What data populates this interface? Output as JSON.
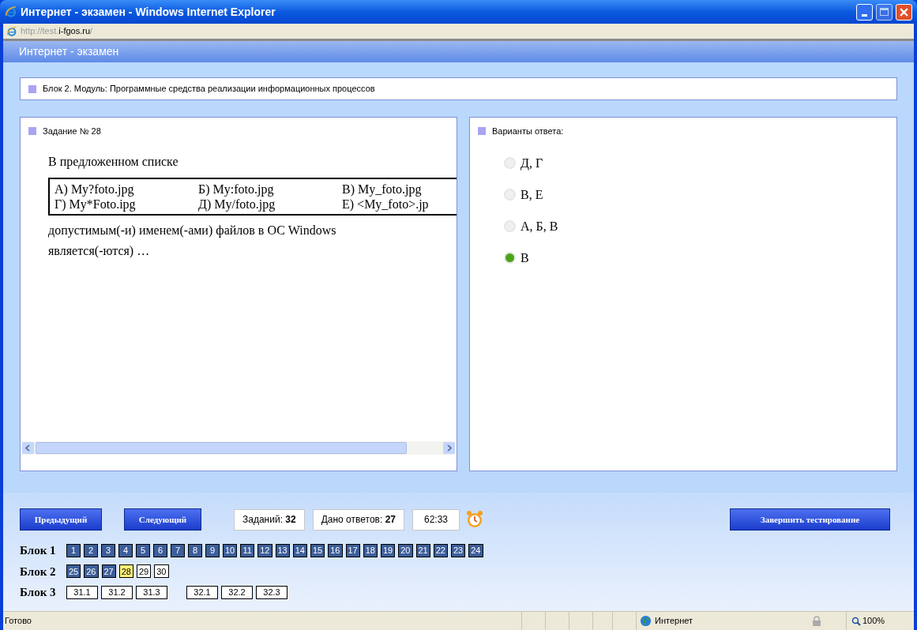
{
  "window": {
    "title": "Интернет - экзамен - Windows Internet Explorer"
  },
  "address": {
    "prefix": "http://test.",
    "domain": "i-fgos.ru",
    "suffix": "/"
  },
  "app_header": {
    "title": "Интернет - экзамен"
  },
  "block_header": {
    "text": "Блок 2. Модуль: Программные средства реализации информационных процессов"
  },
  "question": {
    "title": "Задание № 28",
    "intro": "В предложенном списке",
    "table": [
      [
        "А) My?foto.jpg",
        "Б) My:foto.jpg",
        "В) My_foto.jpg"
      ],
      [
        "Г) My*Foto.ipg",
        "Д) My/foto.jpg",
        "Е) <My_foto>.jp"
      ]
    ],
    "lines": [
      "допустимым(-и) именем(-ами) файлов в ОС Windows",
      "является(-ются) …"
    ]
  },
  "answers": {
    "title": "Варианты ответа:",
    "options": [
      {
        "label": "Д, Г",
        "selected": false
      },
      {
        "label": "В, Е",
        "selected": false
      },
      {
        "label": "А, Б, В",
        "selected": false
      },
      {
        "label": "В",
        "selected": true
      }
    ]
  },
  "toolbar": {
    "prev": "Предыдущий",
    "next": "Следующий",
    "tasks_label": "Заданий:",
    "tasks_value": "32",
    "answered_label": "Дано ответов:",
    "answered_value": "27",
    "timer": "62:33",
    "finish": "Завершить тестирование"
  },
  "blocks": [
    {
      "label": "Блок 1",
      "groups": [
        [
          {
            "n": "1",
            "answered": true,
            "selected": false
          },
          {
            "n": "2",
            "answered": true,
            "selected": false
          },
          {
            "n": "3",
            "answered": true,
            "selected": false
          },
          {
            "n": "4",
            "answered": true,
            "selected": false
          },
          {
            "n": "5",
            "answered": true,
            "selected": false
          },
          {
            "n": "6",
            "answered": true,
            "selected": false
          },
          {
            "n": "7",
            "answered": true,
            "selected": false
          },
          {
            "n": "8",
            "answered": true,
            "selected": false
          },
          {
            "n": "9",
            "answered": true,
            "selected": false
          },
          {
            "n": "10",
            "answered": true,
            "selected": false
          },
          {
            "n": "11",
            "answered": true,
            "selected": false
          },
          {
            "n": "12",
            "answered": true,
            "selected": false
          },
          {
            "n": "13",
            "answered": true,
            "selected": false
          },
          {
            "n": "14",
            "answered": true,
            "selected": false
          },
          {
            "n": "15",
            "answered": true,
            "selected": false
          },
          {
            "n": "16",
            "answered": true,
            "selected": false
          },
          {
            "n": "17",
            "answered": true,
            "selected": false
          },
          {
            "n": "18",
            "answered": true,
            "selected": false
          },
          {
            "n": "19",
            "answered": true,
            "selected": false
          },
          {
            "n": "20",
            "answered": true,
            "selected": false
          },
          {
            "n": "21",
            "answered": true,
            "selected": false
          },
          {
            "n": "22",
            "answered": true,
            "selected": false
          },
          {
            "n": "23",
            "answered": true,
            "selected": false
          },
          {
            "n": "24",
            "answered": true,
            "selected": false
          }
        ]
      ]
    },
    {
      "label": "Блок 2",
      "groups": [
        [
          {
            "n": "25",
            "answered": true,
            "selected": false
          },
          {
            "n": "26",
            "answered": true,
            "selected": false
          },
          {
            "n": "27",
            "answered": true,
            "selected": false
          },
          {
            "n": "28",
            "answered": false,
            "selected": true
          },
          {
            "n": "29",
            "answered": false,
            "selected": false
          },
          {
            "n": "30",
            "answered": false,
            "selected": false
          }
        ]
      ]
    },
    {
      "label": "Блок 3",
      "groups": [
        [
          {
            "n": "31.1",
            "answered": false,
            "selected": false
          },
          {
            "n": "31.2",
            "answered": false,
            "selected": false
          },
          {
            "n": "31.3",
            "answered": false,
            "selected": false
          }
        ],
        [
          {
            "n": "32.1",
            "answered": false,
            "selected": false
          },
          {
            "n": "32.2",
            "answered": false,
            "selected": false
          },
          {
            "n": "32.3",
            "answered": false,
            "selected": false
          }
        ]
      ]
    }
  ],
  "status_bar": {
    "text": "Готово",
    "zone": "Интернет",
    "zoom": "100%"
  }
}
